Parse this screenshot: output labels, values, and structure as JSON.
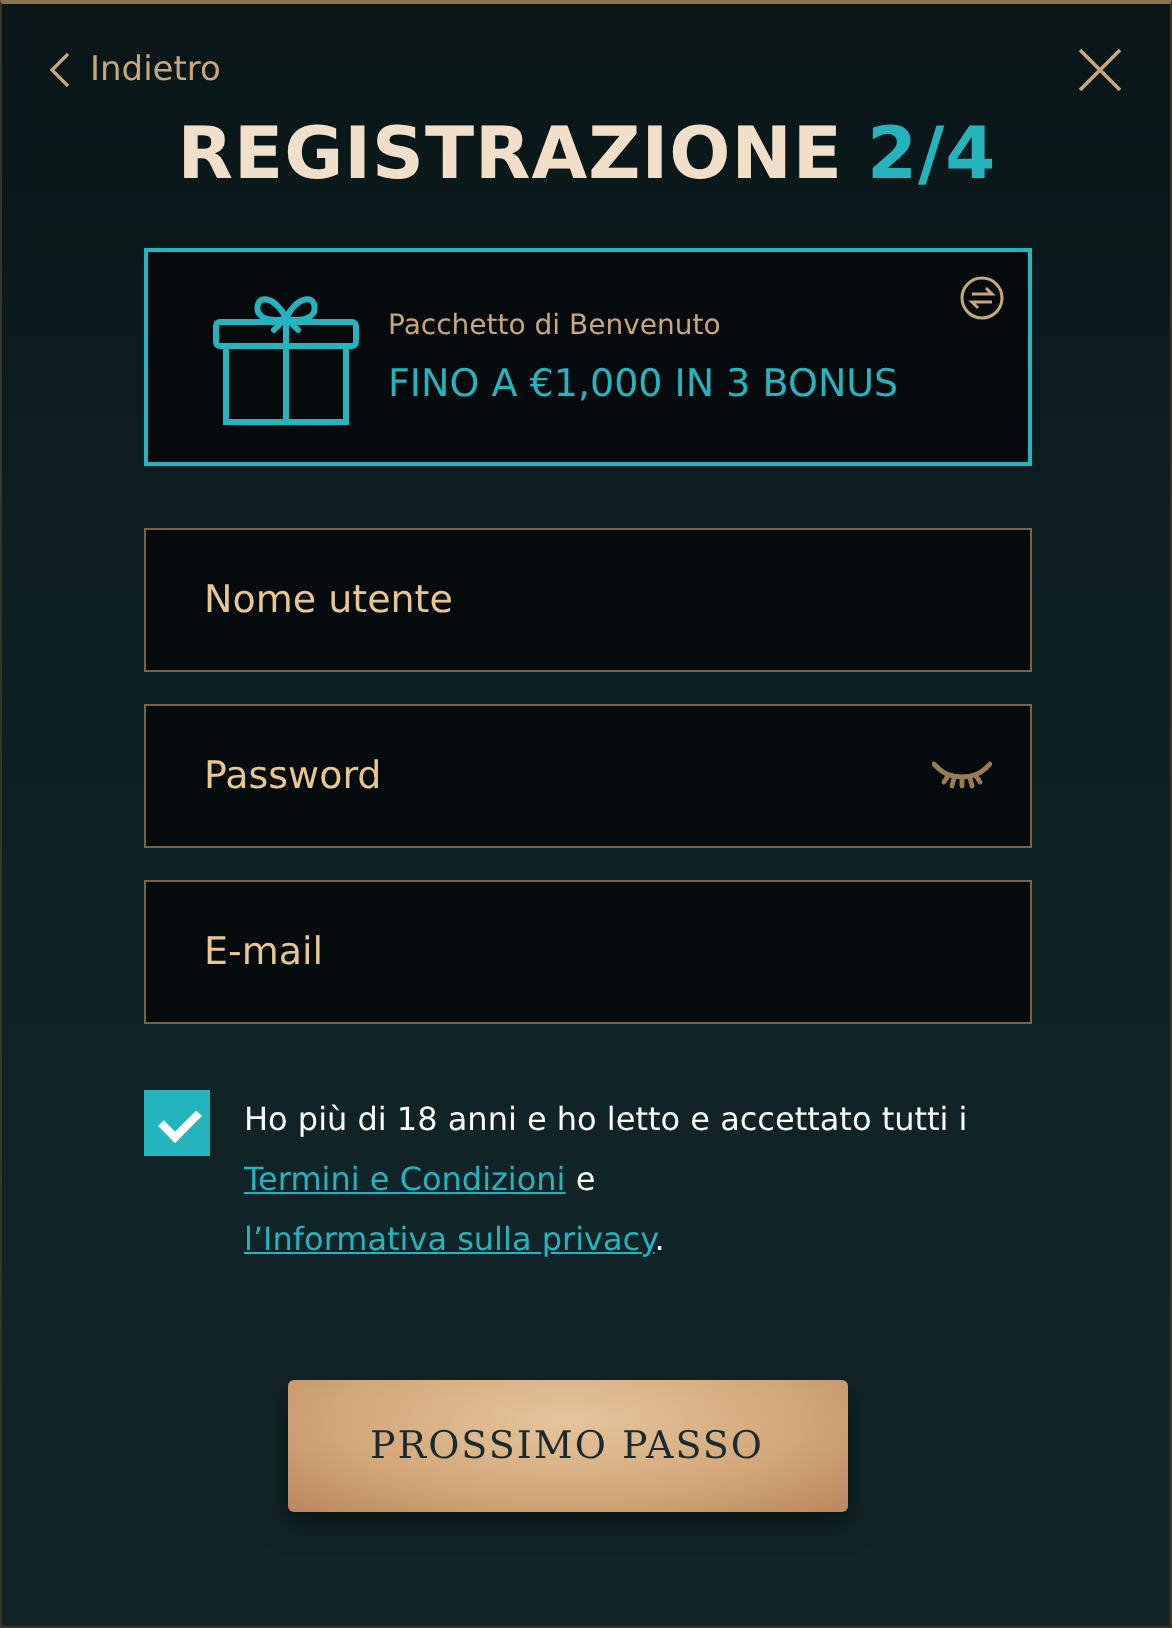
{
  "header": {
    "back": "Indietro",
    "title": "REGISTRAZIONE",
    "step": "2/4"
  },
  "bonus": {
    "caption": "Pacchetto di Benvenuto",
    "offer": "FINO A €1,000 IN 3 BONUS"
  },
  "fields": [
    {
      "kind": "text",
      "placeholder": "Nome utente"
    },
    {
      "kind": "password",
      "placeholder": "Password"
    },
    {
      "kind": "text",
      "placeholder": "E-mail"
    }
  ],
  "agreement": {
    "checked": true,
    "parts": [
      {
        "kind": "text",
        "text": "Ho più di 18 anni e ho letto e accettato tutti i "
      },
      {
        "kind": "link",
        "text": "Termini e Condizioni"
      },
      {
        "kind": "text",
        "text": " e "
      },
      {
        "kind": "link",
        "text": "l’Informativa sulla privacy"
      },
      {
        "kind": "text",
        "text": "."
      }
    ]
  },
  "submit": "PROSSIMO PASSO"
}
